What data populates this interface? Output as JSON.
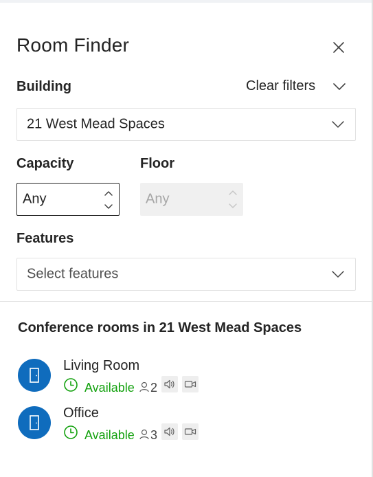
{
  "panel": {
    "title": "Room Finder",
    "close_icon": "close-icon"
  },
  "filters": {
    "building_label": "Building",
    "clear_filters": "Clear filters",
    "building_value": "21 West Mead Spaces",
    "capacity_label": "Capacity",
    "capacity_value": "Any",
    "floor_label": "Floor",
    "floor_value": "Any",
    "floor_disabled": true,
    "features_label": "Features",
    "features_placeholder": "Select features"
  },
  "results": {
    "title": "Conference rooms in 21 West Mead Spaces",
    "rooms": [
      {
        "name": "Living Room",
        "status": "Available",
        "capacity": "2",
        "features": [
          "audio-icon",
          "video-icon"
        ]
      },
      {
        "name": "Office",
        "status": "Available",
        "capacity": "3",
        "features": [
          "audio-icon",
          "video-icon"
        ]
      }
    ]
  },
  "colors": {
    "accent": "#0f6cbd",
    "available": "#13a10e",
    "text": "#242424",
    "border": "#e1e1e1"
  }
}
